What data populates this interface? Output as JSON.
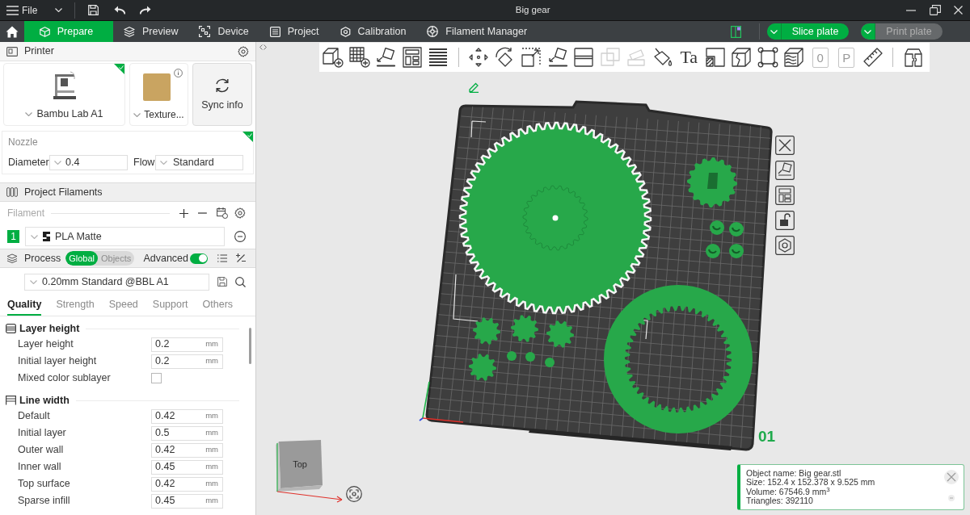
{
  "title_bar": {
    "menu": "File",
    "title": "Big gear"
  },
  "tabs": [
    {
      "label": "Prepare",
      "selected": true
    },
    {
      "label": "Preview",
      "selected": false
    },
    {
      "label": "Device",
      "selected": false
    },
    {
      "label": "Project",
      "selected": false
    },
    {
      "label": "Calibration",
      "selected": false
    },
    {
      "label": "Filament Manager",
      "selected": false
    }
  ],
  "actions": [
    {
      "label": "Slice plate",
      "disabled": false
    },
    {
      "label": "Print plate",
      "disabled": true
    }
  ],
  "printer": {
    "title": "Printer",
    "model": "Bambu Lab A1",
    "model_synced": true,
    "plate": "Texture...",
    "sync_button": "Sync info"
  },
  "nozzle": {
    "title": "Nozzle",
    "synced": true,
    "diameter_label": "Diameter",
    "diameter": "0.4",
    "flow_label": "Flow",
    "flow": "Standard"
  },
  "filaments": {
    "title": "Project Filaments",
    "label": "Filament",
    "items": [
      {
        "number": "1",
        "color": "#00ae42",
        "name": "PLA Matte"
      }
    ]
  },
  "process": {
    "title": "Process",
    "scopes": [
      {
        "label": "Global",
        "selected": true
      },
      {
        "label": "Objects",
        "selected": false
      }
    ],
    "advanced_label": "Advanced",
    "advanced_on": true,
    "preset": "0.20mm Standard @BBL A1",
    "tabs": [
      {
        "label": "Quality",
        "selected": true
      },
      {
        "label": "Strength",
        "selected": false
      },
      {
        "label": "Speed",
        "selected": false
      },
      {
        "label": "Support",
        "selected": false
      },
      {
        "label": "Others",
        "selected": false
      }
    ],
    "groups": [
      {
        "title": "Layer height",
        "rows": [
          {
            "kind": "number",
            "label": "Layer height",
            "value": "0.2",
            "unit": "mm"
          },
          {
            "kind": "number",
            "label": "Initial layer height",
            "value": "0.2",
            "unit": "mm"
          },
          {
            "kind": "checkbox",
            "label": "Mixed color sublayer",
            "checked": false
          }
        ]
      },
      {
        "title": "Line width",
        "rows": [
          {
            "kind": "number",
            "label": "Default",
            "value": "0.42",
            "unit": "mm"
          },
          {
            "kind": "number",
            "label": "Initial layer",
            "value": "0.5",
            "unit": "mm"
          },
          {
            "kind": "number",
            "label": "Outer wall",
            "value": "0.42",
            "unit": "mm"
          },
          {
            "kind": "number",
            "label": "Inner wall",
            "value": "0.45",
            "unit": "mm"
          },
          {
            "kind": "number",
            "label": "Top surface",
            "value": "0.42",
            "unit": "mm"
          },
          {
            "kind": "number",
            "label": "Sparse infill",
            "value": "0.45",
            "unit": "mm"
          }
        ]
      }
    ]
  },
  "toolbar": {
    "groups": [
      [
        {
          "disabled": false
        },
        {
          "disabled": false
        },
        {
          "disabled": false
        },
        {
          "disabled": false
        },
        {
          "disabled": false
        }
      ],
      [
        {
          "disabled": false
        },
        {
          "disabled": false
        },
        {
          "disabled": false
        },
        {
          "disabled": false
        },
        {
          "disabled": false
        },
        {
          "disabled": true
        },
        {
          "disabled": true
        },
        {
          "disabled": false
        },
        {
          "glyph": "Ta",
          "disabled": false
        },
        {
          "disabled": false
        },
        {
          "disabled": false
        },
        {
          "disabled": false
        },
        {
          "disabled": false
        },
        {
          "glyph": "0",
          "disabled": true
        },
        {
          "glyph": "P",
          "disabled": true
        },
        {
          "disabled": false
        }
      ],
      [
        {
          "disabled": false
        }
      ]
    ]
  },
  "viewport": {
    "plate_number": "01",
    "view_cube": "Top",
    "object_info": [
      "Object name: Big gear.stl",
      "Size: 152.4 x 152.378 x 9.525 mm",
      "Volume: 67546.9 mm$^{3}$",
      "Triangles: 392110"
    ]
  }
}
